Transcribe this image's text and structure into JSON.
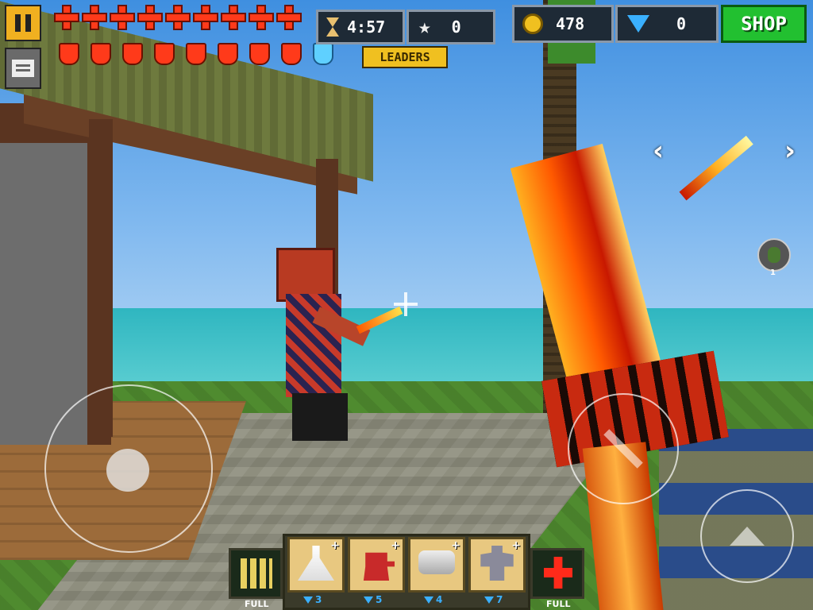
{
  "hud": {
    "timer": "4:57",
    "kills": "0",
    "leaders_label": "LEADERS",
    "coins": "478",
    "gems": "0",
    "shop_label": "SHOP",
    "health_count": 9,
    "armor_count": 9,
    "grenade_count": "1"
  },
  "toolbar": {
    "ammo_label": "FULL",
    "medkit_label": "FULL",
    "items": [
      {
        "icon": "potion-icon",
        "price": "3"
      },
      {
        "icon": "turret-icon",
        "price": "5"
      },
      {
        "icon": "jetpack-icon",
        "price": "4"
      },
      {
        "icon": "mech-icon",
        "price": "7"
      }
    ]
  },
  "colors": {
    "shop_green": "#22c030",
    "pause_yellow": "#f0b020",
    "gem_blue": "#3ab0ff",
    "health_red": "#ff3a1a"
  }
}
